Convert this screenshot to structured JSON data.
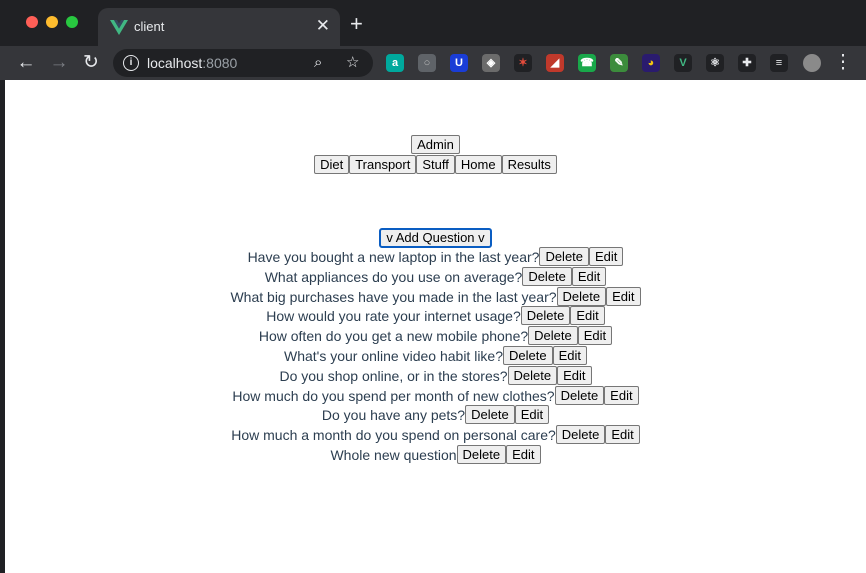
{
  "browser": {
    "tab_title": "client",
    "tab_close": "✕",
    "new_tab": "+",
    "url_host": "localhost",
    "url_port": ":8080",
    "extensions": [
      "a",
      "○",
      "U",
      "◈",
      "✶",
      "◢",
      "☎",
      "✎",
      "◕",
      "V",
      "⚛",
      "✚",
      "≡"
    ]
  },
  "nav": {
    "top": [
      "Admin"
    ],
    "main": [
      "Diet",
      "Transport",
      "Stuff",
      "Home",
      "Results"
    ]
  },
  "add_question_label": "v Add Question v",
  "question_actions": {
    "delete": "Delete",
    "edit": "Edit"
  },
  "questions": [
    "Have you bought a new laptop in the last year?",
    "What appliances do you use on average?",
    "What big purchases have you made in the last year?",
    "How would you rate your internet usage?",
    "How often do you get a new mobile phone?",
    "What's your online video habit like?",
    "Do you shop online, or in the stores?",
    "How much do you spend per month of new clothes?",
    "Do you have any pets?",
    "How much a month do you spend on personal care?",
    "Whole new question"
  ],
  "colors": {
    "accent": "#0a5dc2",
    "text": "#2c3e50",
    "vue_green": "#41b883"
  }
}
